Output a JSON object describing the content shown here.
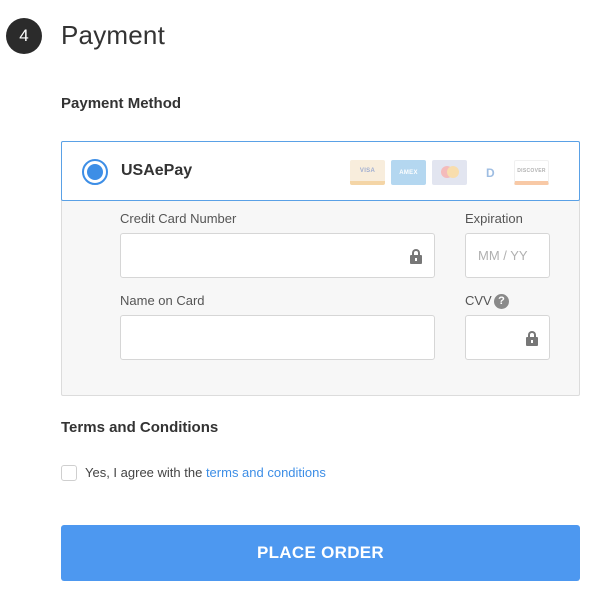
{
  "step": {
    "number": "4",
    "title": "Payment"
  },
  "payment_method": {
    "section_label": "Payment Method",
    "option_name": "USAePay",
    "selected": true,
    "card_logos": [
      {
        "name": "visa",
        "text": "VISA"
      },
      {
        "name": "amex",
        "text": "AMEX"
      },
      {
        "name": "mastercard",
        "text": ""
      },
      {
        "name": "diners",
        "text": "D"
      },
      {
        "name": "discover",
        "text": "DISCOVER"
      }
    ]
  },
  "form": {
    "card_number": {
      "label": "Credit Card Number",
      "value": "",
      "placeholder": ""
    },
    "expiration": {
      "label": "Expiration",
      "value": "",
      "placeholder": "MM / YY"
    },
    "name_on_card": {
      "label": "Name on Card",
      "value": "",
      "placeholder": ""
    },
    "cvv": {
      "label": "CVV",
      "value": "",
      "placeholder": "",
      "help": "?"
    }
  },
  "terms": {
    "section_label": "Terms and Conditions",
    "agree_prefix": "Yes, I agree with the ",
    "agree_link": "terms and conditions",
    "checked": false
  },
  "actions": {
    "place_order_label": "PLACE ORDER"
  },
  "colors": {
    "accent": "#4d98f0",
    "radio": "#3d8ee6",
    "link": "#3d8ee6"
  }
}
